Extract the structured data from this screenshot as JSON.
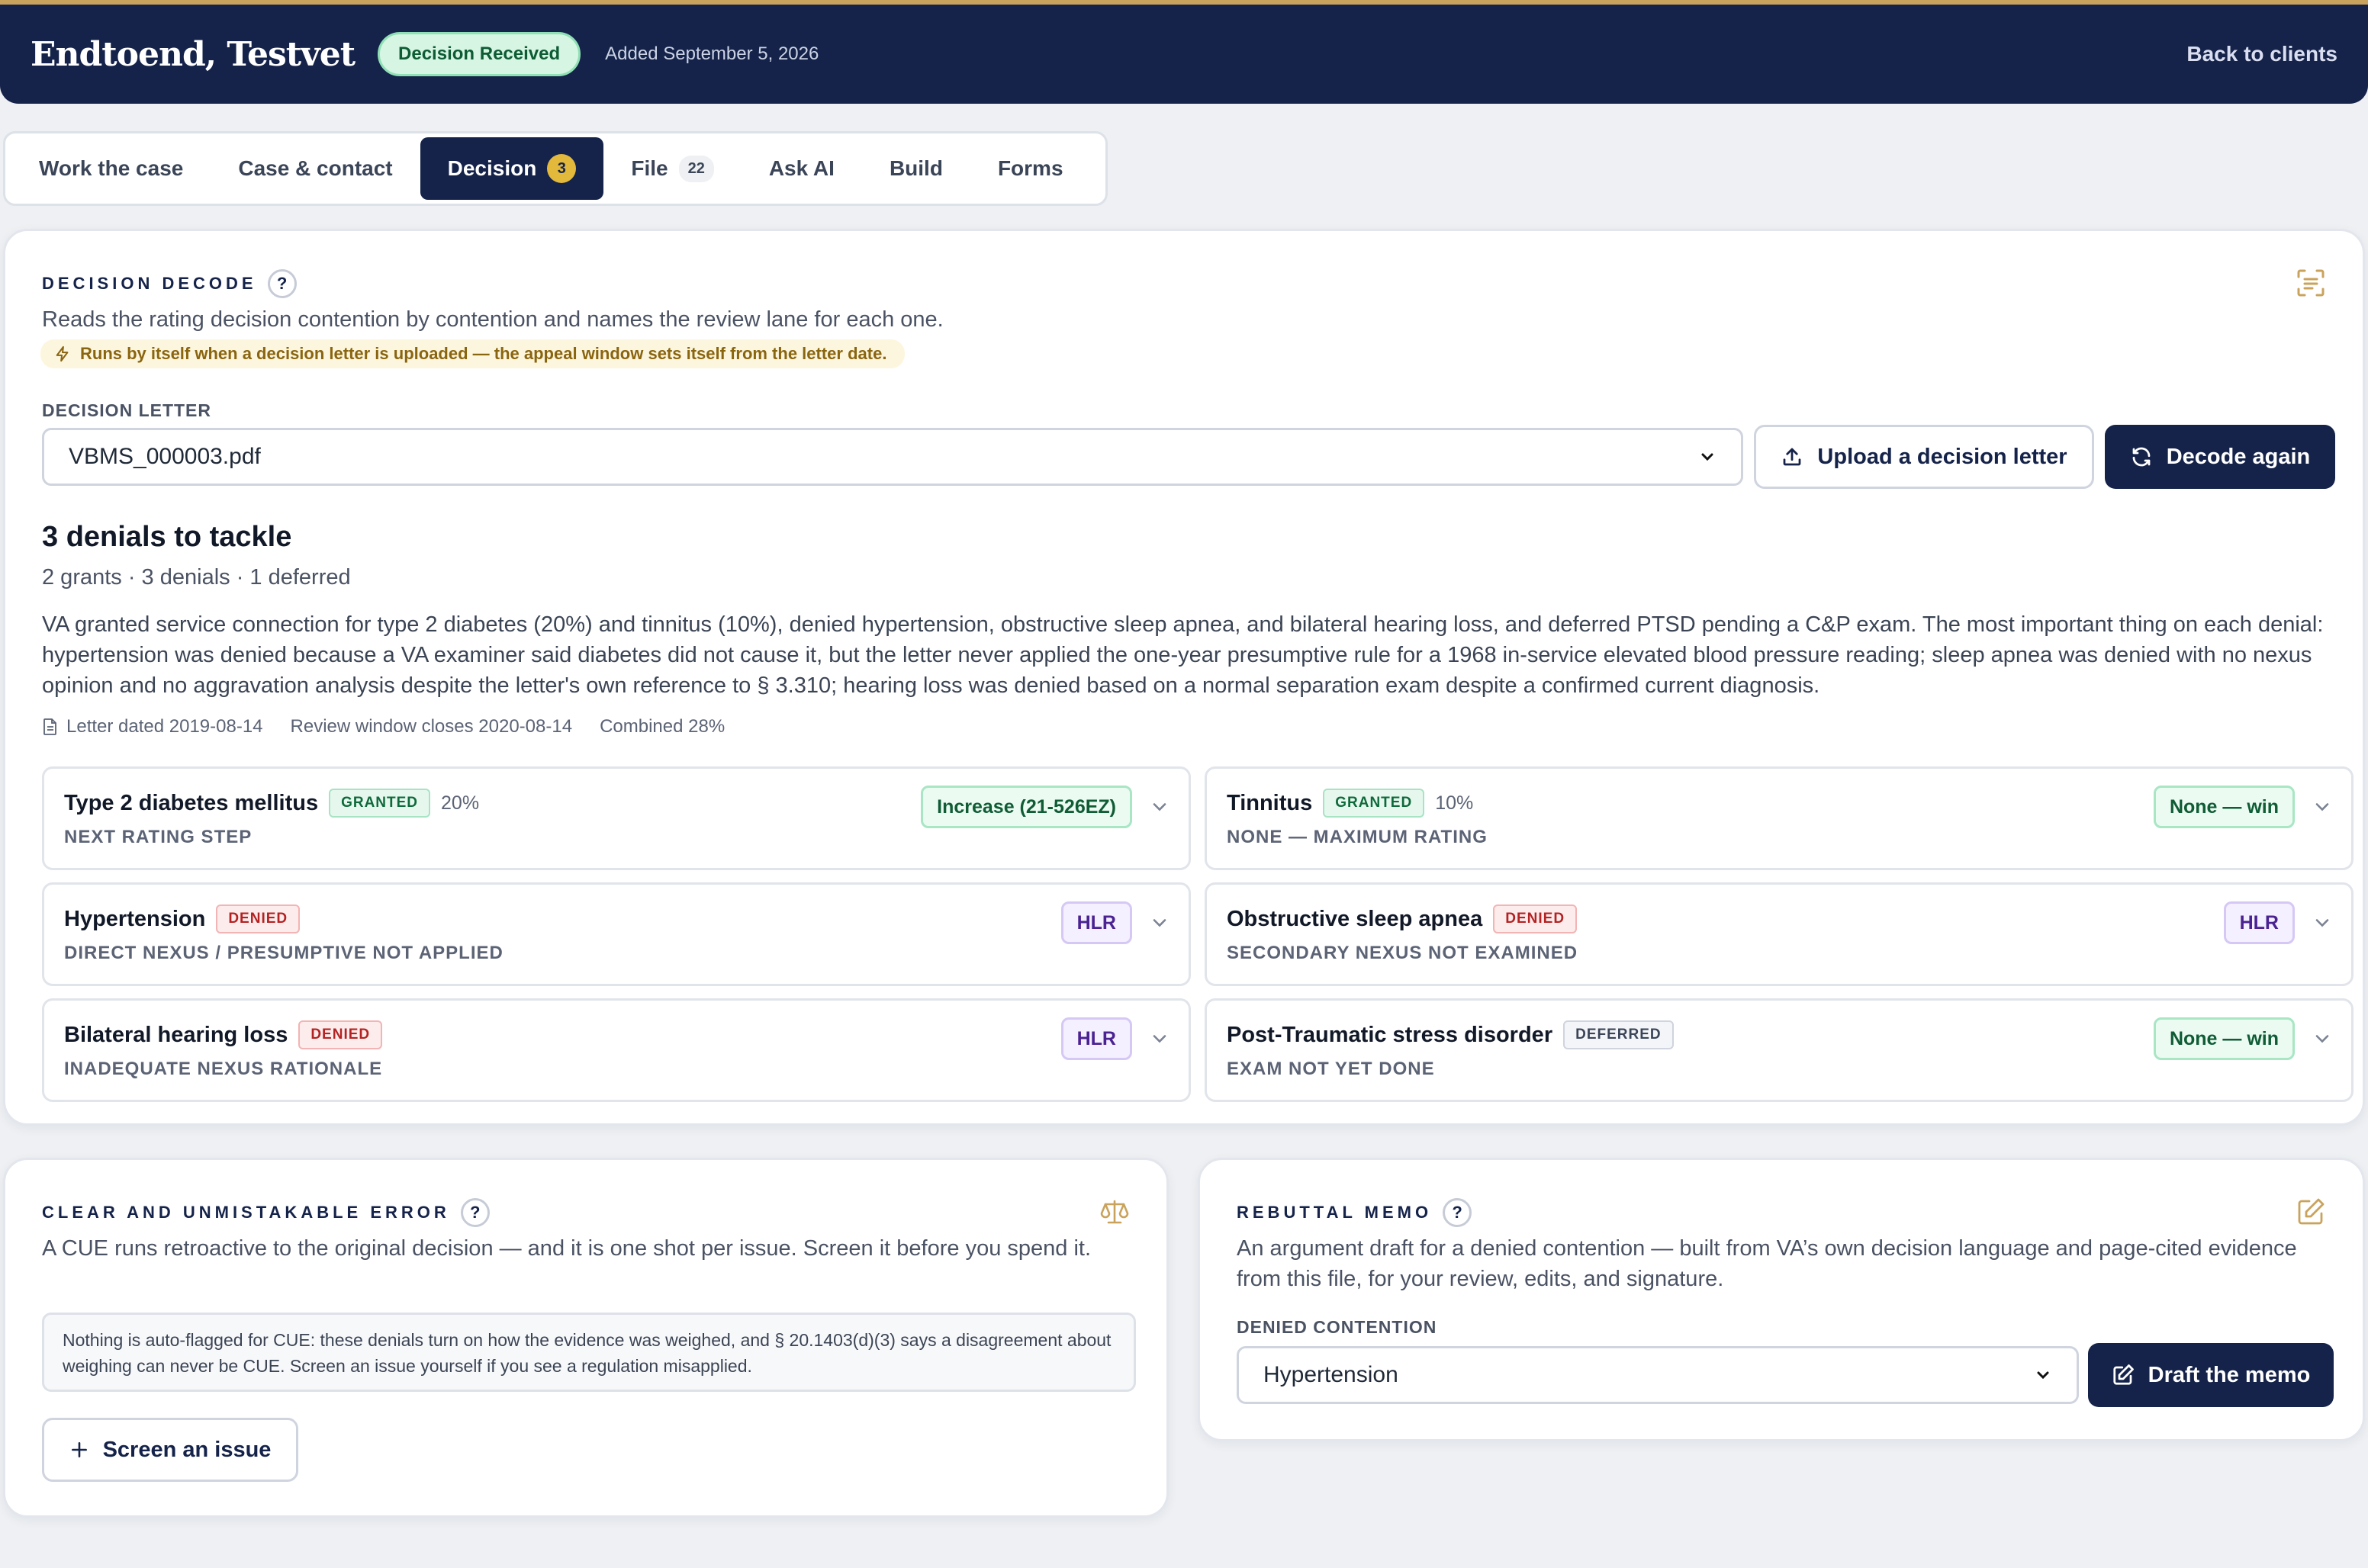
{
  "header": {
    "client_name": "Endtoend, Testvet",
    "status": "Decision Received",
    "added": "Added September 5, 2026",
    "back": "Back to clients"
  },
  "tabs": [
    {
      "label": "Work the case"
    },
    {
      "label": "Case & contact"
    },
    {
      "label": "Decision",
      "badge": "3"
    },
    {
      "label": "File",
      "count": "22"
    },
    {
      "label": "Ask AI"
    },
    {
      "label": "Build"
    },
    {
      "label": "Forms"
    }
  ],
  "decode": {
    "title": "DECISION DECODE",
    "help": "?",
    "description": "Reads the rating decision contention by contention and names the review lane for each one.",
    "auto_note": "Runs by itself when a decision letter is uploaded — the appeal window sets itself from the letter date.",
    "letter_label": "DECISION LETTER",
    "letter_value": "VBMS_000003.pdf",
    "upload_label": "Upload a decision letter",
    "decode_label": "Decode again",
    "headline": "3 denials to tackle",
    "stats": "2 grants · 3 denials · 1 deferred",
    "summary": "VA granted service connection for type 2 diabetes (20%) and tinnitus (10%), denied hypertension, obstructive sleep apnea, and bilateral hearing loss, and deferred PTSD pending a C&P exam. The most important thing on each denial: hypertension was denied because a VA examiner said diabetes did not cause it, but the letter never applied the one-year presumptive rule for a 1968 in-service elevated blood pressure reading; sleep apnea was denied with no nexus opinion and no aggravation analysis despite the letter's own reference to § 3.310; hearing loss was denied based on a normal separation exam despite a confirmed current diagnosis.",
    "letter_dated": "Letter dated 2019-08-14",
    "review_window": "Review window closes 2020-08-14",
    "combined": "Combined 28%"
  },
  "contentions": [
    {
      "name": "Type 2 diabetes mellitus",
      "tag": "GRANTED",
      "pct": "20%",
      "reason": "NEXT RATING STEP",
      "lane": "Increase (21-526EZ)"
    },
    {
      "name": "Tinnitus",
      "tag": "GRANTED",
      "pct": "10%",
      "reason": "NONE — MAXIMUM RATING",
      "lane": "None — win"
    },
    {
      "name": "Hypertension",
      "tag": "DENIED",
      "pct": "",
      "reason": "DIRECT NEXUS / PRESUMPTIVE NOT APPLIED",
      "lane": "HLR"
    },
    {
      "name": "Obstructive sleep apnea",
      "tag": "DENIED",
      "pct": "",
      "reason": "SECONDARY NEXUS NOT EXAMINED",
      "lane": "HLR"
    },
    {
      "name": "Bilateral hearing loss",
      "tag": "DENIED",
      "pct": "",
      "reason": "INADEQUATE NEXUS RATIONALE",
      "lane": "HLR"
    },
    {
      "name": "Post-Traumatic stress disorder",
      "tag": "DEFERRED",
      "pct": "",
      "reason": "EXAM NOT YET DONE",
      "lane": "None — win"
    }
  ],
  "cue": {
    "title": "CLEAR AND UNMISTAKABLE ERROR",
    "help": "?",
    "description": "A CUE runs retroactive to the original decision — and it is one shot per issue. Screen it before you spend it.",
    "note": "Nothing is auto-flagged for CUE: these denials turn on how the evidence was weighed, and § 20.1403(d)(3) says a disagreement about weighing can never be CUE. Screen an issue yourself if you see a regulation misapplied.",
    "button": "Screen an issue"
  },
  "memo": {
    "title": "REBUTTAL MEMO",
    "help": "?",
    "description": "An argument draft for a denied contention — built from VA’s own decision language and page-cited evidence from this file, for your review, edits, and signature.",
    "field_label": "DENIED CONTENTION",
    "field_value": "Hypertension",
    "button": "Draft the memo"
  },
  "colors": {
    "navy": "#15234a",
    "gold": "#c9a35c",
    "granted": "#0f6a3b",
    "denied": "#b42323",
    "hlr": "#4a2391"
  }
}
